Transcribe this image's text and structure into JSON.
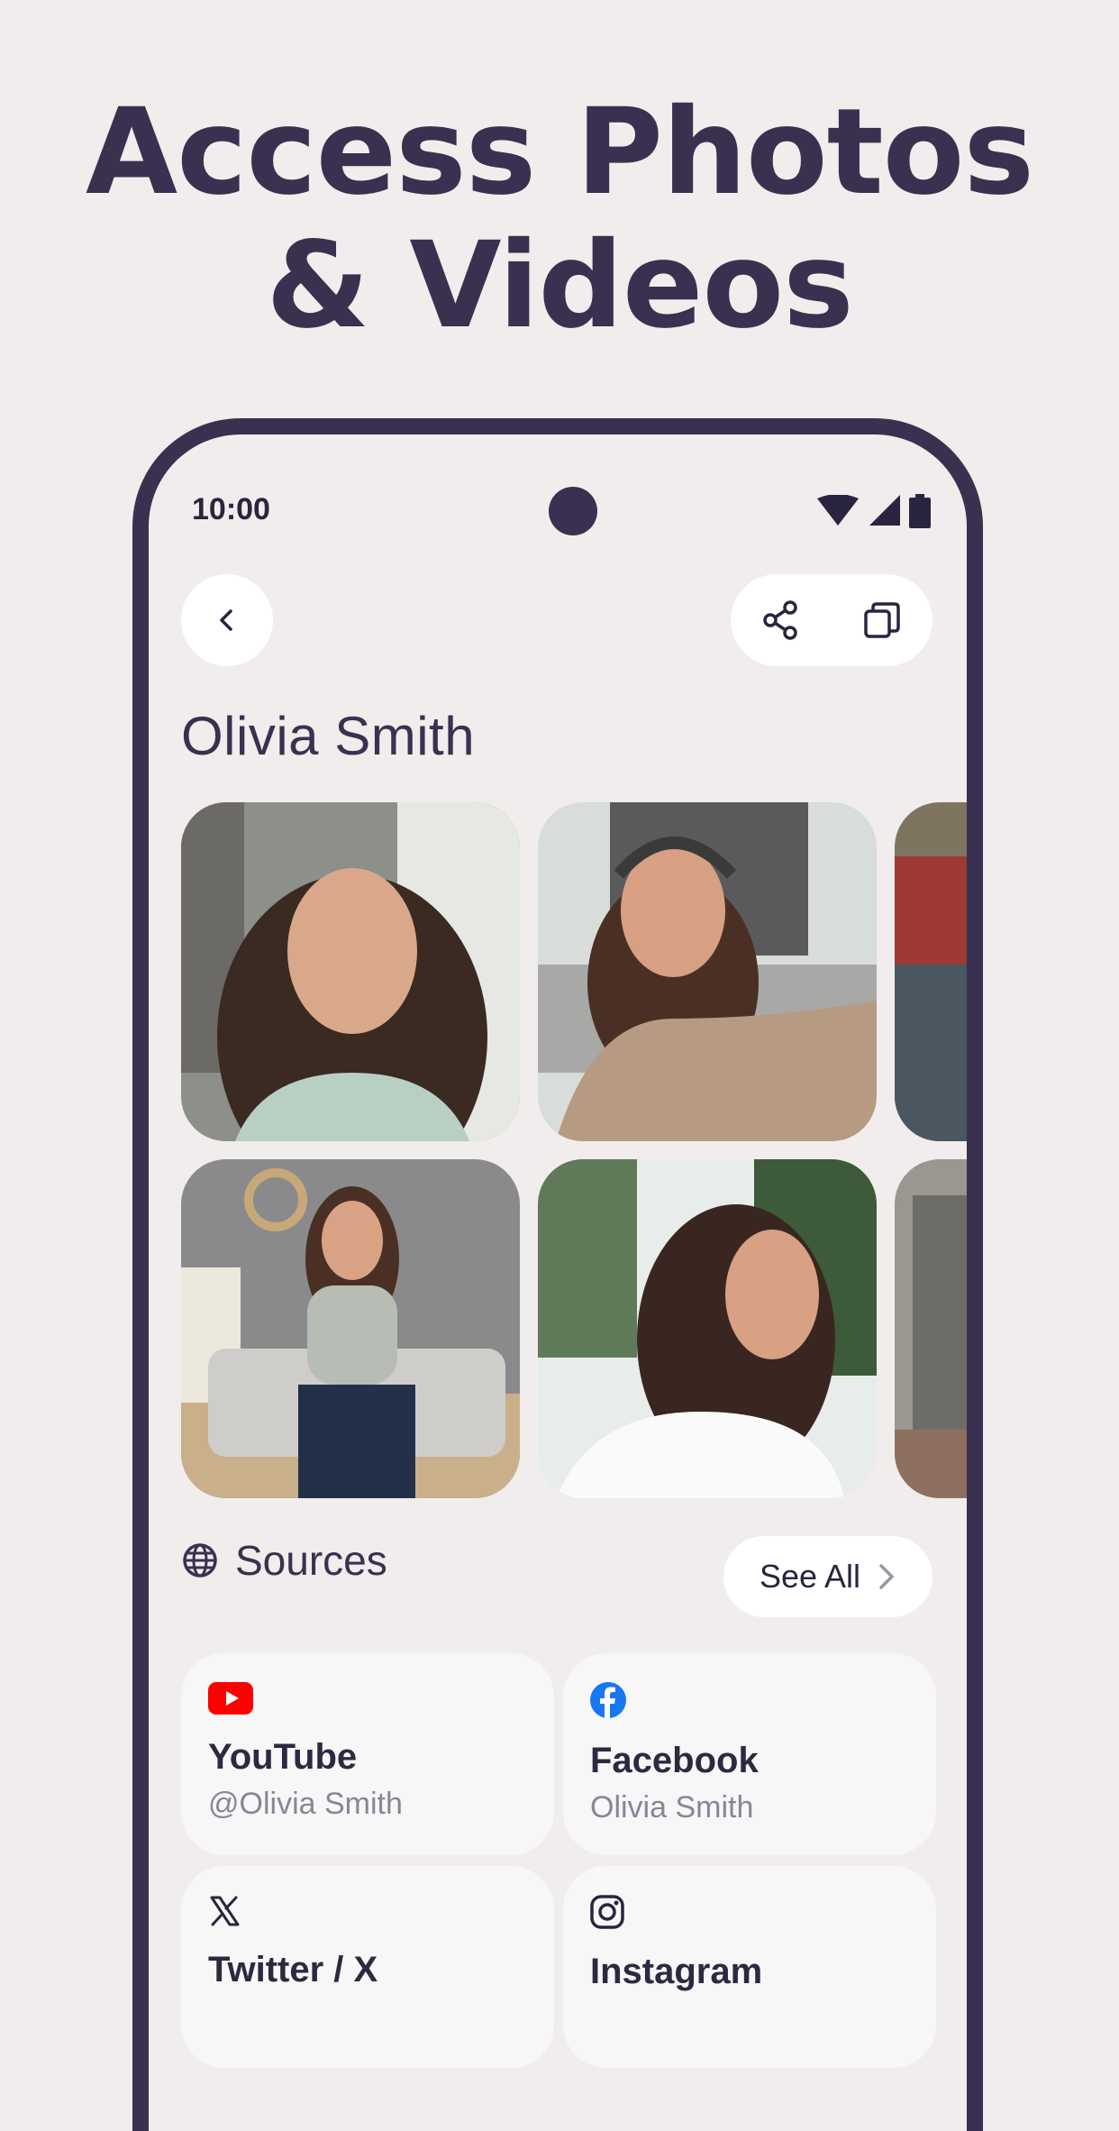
{
  "headline": {
    "line1": "Access Photos",
    "line2": "& Videos"
  },
  "status_bar": {
    "time": "10:00"
  },
  "profile": {
    "name": "Olivia Smith"
  },
  "sources": {
    "title": "Sources",
    "see_all_label": "See All",
    "cards": [
      {
        "platform": "YouTube",
        "handle": "@Olivia Smith",
        "icon": "youtube-icon"
      },
      {
        "platform": "Facebook",
        "handle": "Olivia Smith",
        "icon": "facebook-icon"
      },
      {
        "platform": "Twitter / X",
        "handle": "",
        "icon": "x-icon"
      },
      {
        "platform": "Instagram",
        "handle": "",
        "icon": "instagram-icon"
      }
    ]
  },
  "colors": {
    "accent": "#3A3150",
    "background": "#F0EDEC",
    "youtube": "#FF0000",
    "facebook": "#1877F2"
  }
}
